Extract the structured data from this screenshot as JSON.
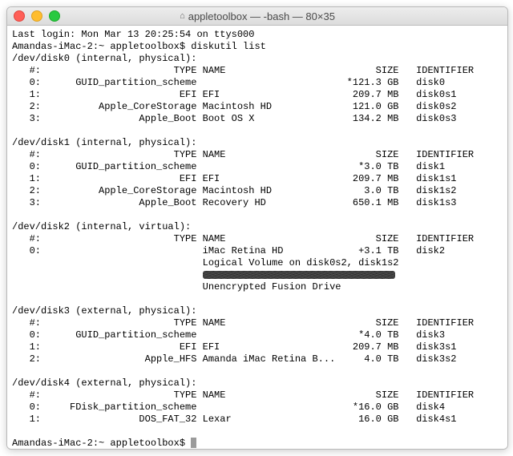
{
  "window": {
    "title": "appletoolbox — -bash — 80×35"
  },
  "login_line": "Last login: Mon Mar 13 20:25:54 on ttys000",
  "prompt": "Amandas-iMac-2:~ appletoolbox$",
  "command": "diskutil list",
  "disks": [
    {
      "device": "/dev/disk0",
      "attrs": "(internal, physical)",
      "header": {
        "idx": "#:",
        "type": "TYPE",
        "name": "NAME",
        "size": "SIZE",
        "ident": "IDENTIFIER"
      },
      "rows": [
        {
          "idx": "0:",
          "type": "GUID_partition_scheme",
          "name": "",
          "size": "*121.3 GB",
          "ident": "disk0"
        },
        {
          "idx": "1:",
          "type": "EFI",
          "name": "EFI",
          "size": "209.7 MB",
          "ident": "disk0s1"
        },
        {
          "idx": "2:",
          "type": "Apple_CoreStorage",
          "name": "Macintosh HD",
          "size": "121.0 GB",
          "ident": "disk0s2"
        },
        {
          "idx": "3:",
          "type": "Apple_Boot",
          "name": "Boot OS X",
          "size": "134.2 MB",
          "ident": "disk0s3"
        }
      ]
    },
    {
      "device": "/dev/disk1",
      "attrs": "(internal, physical)",
      "header": {
        "idx": "#:",
        "type": "TYPE",
        "name": "NAME",
        "size": "SIZE",
        "ident": "IDENTIFIER"
      },
      "rows": [
        {
          "idx": "0:",
          "type": "GUID_partition_scheme",
          "name": "",
          "size": "*3.0 TB",
          "ident": "disk1"
        },
        {
          "idx": "1:",
          "type": "EFI",
          "name": "EFI",
          "size": "209.7 MB",
          "ident": "disk1s1"
        },
        {
          "idx": "2:",
          "type": "Apple_CoreStorage",
          "name": "Macintosh HD",
          "size": "3.0 TB",
          "ident": "disk1s2"
        },
        {
          "idx": "3:",
          "type": "Apple_Boot",
          "name": "Recovery HD",
          "size": "650.1 MB",
          "ident": "disk1s3"
        }
      ]
    },
    {
      "device": "/dev/disk2",
      "attrs": "(internal, virtual)",
      "header": {
        "idx": "#:",
        "type": "TYPE",
        "name": "NAME",
        "size": "SIZE",
        "ident": "IDENTIFIER"
      },
      "rows": [
        {
          "idx": "0:",
          "type": "",
          "name": "iMac Retina HD",
          "size": "+3.1 TB",
          "ident": "disk2"
        }
      ],
      "extra": [
        "Logical Volume on disk0s2, disk1s2",
        "REDACTED",
        "Unencrypted Fusion Drive"
      ]
    },
    {
      "device": "/dev/disk3",
      "attrs": "(external, physical)",
      "header": {
        "idx": "#:",
        "type": "TYPE",
        "name": "NAME",
        "size": "SIZE",
        "ident": "IDENTIFIER"
      },
      "rows": [
        {
          "idx": "0:",
          "type": "GUID_partition_scheme",
          "name": "",
          "size": "*4.0 TB",
          "ident": "disk3"
        },
        {
          "idx": "1:",
          "type": "EFI",
          "name": "EFI",
          "size": "209.7 MB",
          "ident": "disk3s1"
        },
        {
          "idx": "2:",
          "type": "Apple_HFS",
          "name": "Amanda iMac Retina B...",
          "size": "4.0 TB",
          "ident": "disk3s2"
        }
      ]
    },
    {
      "device": "/dev/disk4",
      "attrs": "(external, physical)",
      "header": {
        "idx": "#:",
        "type": "TYPE",
        "name": "NAME",
        "size": "SIZE",
        "ident": "IDENTIFIER"
      },
      "rows": [
        {
          "idx": "0:",
          "type": "FDisk_partition_scheme",
          "name": "",
          "size": "*16.0 GB",
          "ident": "disk4"
        },
        {
          "idx": "1:",
          "type": "DOS_FAT_32",
          "name": "Lexar",
          "size": "16.0 GB",
          "ident": "disk4s1"
        }
      ]
    }
  ]
}
